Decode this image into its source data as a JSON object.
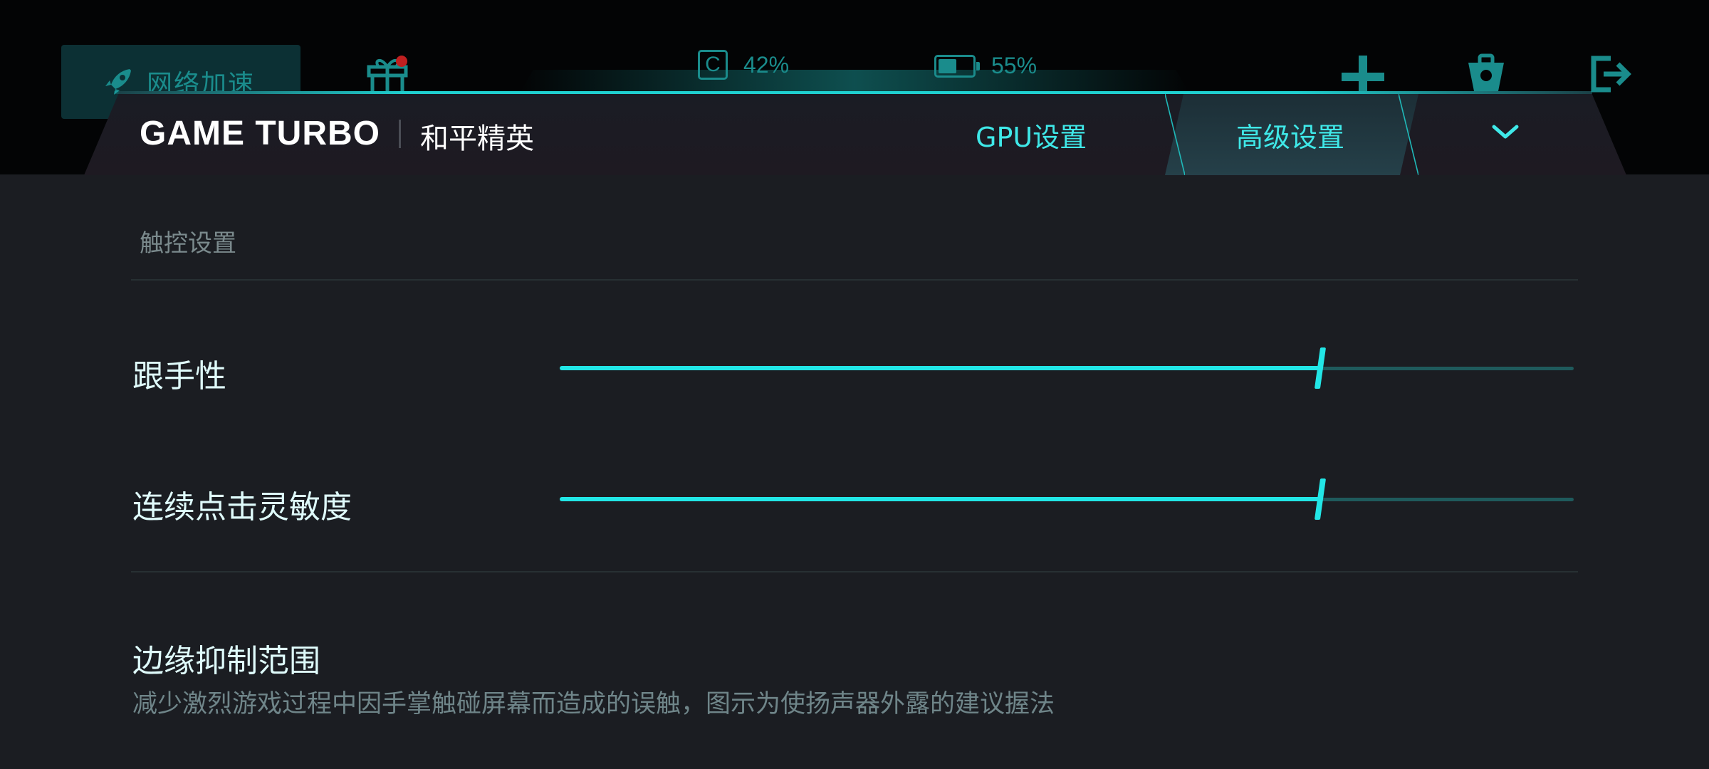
{
  "topbar": {
    "network_boost": "网络加速",
    "cpu_usage": "42%",
    "cpu_glyph": "C",
    "battery_level": "55%",
    "battery_fraction": 0.55,
    "icons": [
      "rocket-icon",
      "gift-icon",
      "cpu-icon",
      "battery-icon",
      "plus-icon",
      "toolbox-icon",
      "exit-icon"
    ]
  },
  "header": {
    "brand": "GAME TURBO",
    "game_name": "和平精英",
    "tabs": [
      {
        "label": "GPU设置",
        "active": false
      },
      {
        "label": "高级设置",
        "active": true
      }
    ],
    "collapse_icon": "chevron-down-icon"
  },
  "touch": {
    "section_title": "触控设置",
    "sliders": [
      {
        "label": "跟手性",
        "value": 0.75
      },
      {
        "label": "连续点击灵敏度",
        "value": 0.75
      }
    ]
  },
  "edge": {
    "title": "边缘抑制范围",
    "description": "减少激烈游戏过程中因手掌触碰屏幕而造成的误触，图示为使扬声器外露的建议握法"
  },
  "colors": {
    "accent": "#22e6e6",
    "panel_bg": "#1b1d22",
    "topbar_icon": "#1a8c8c"
  }
}
